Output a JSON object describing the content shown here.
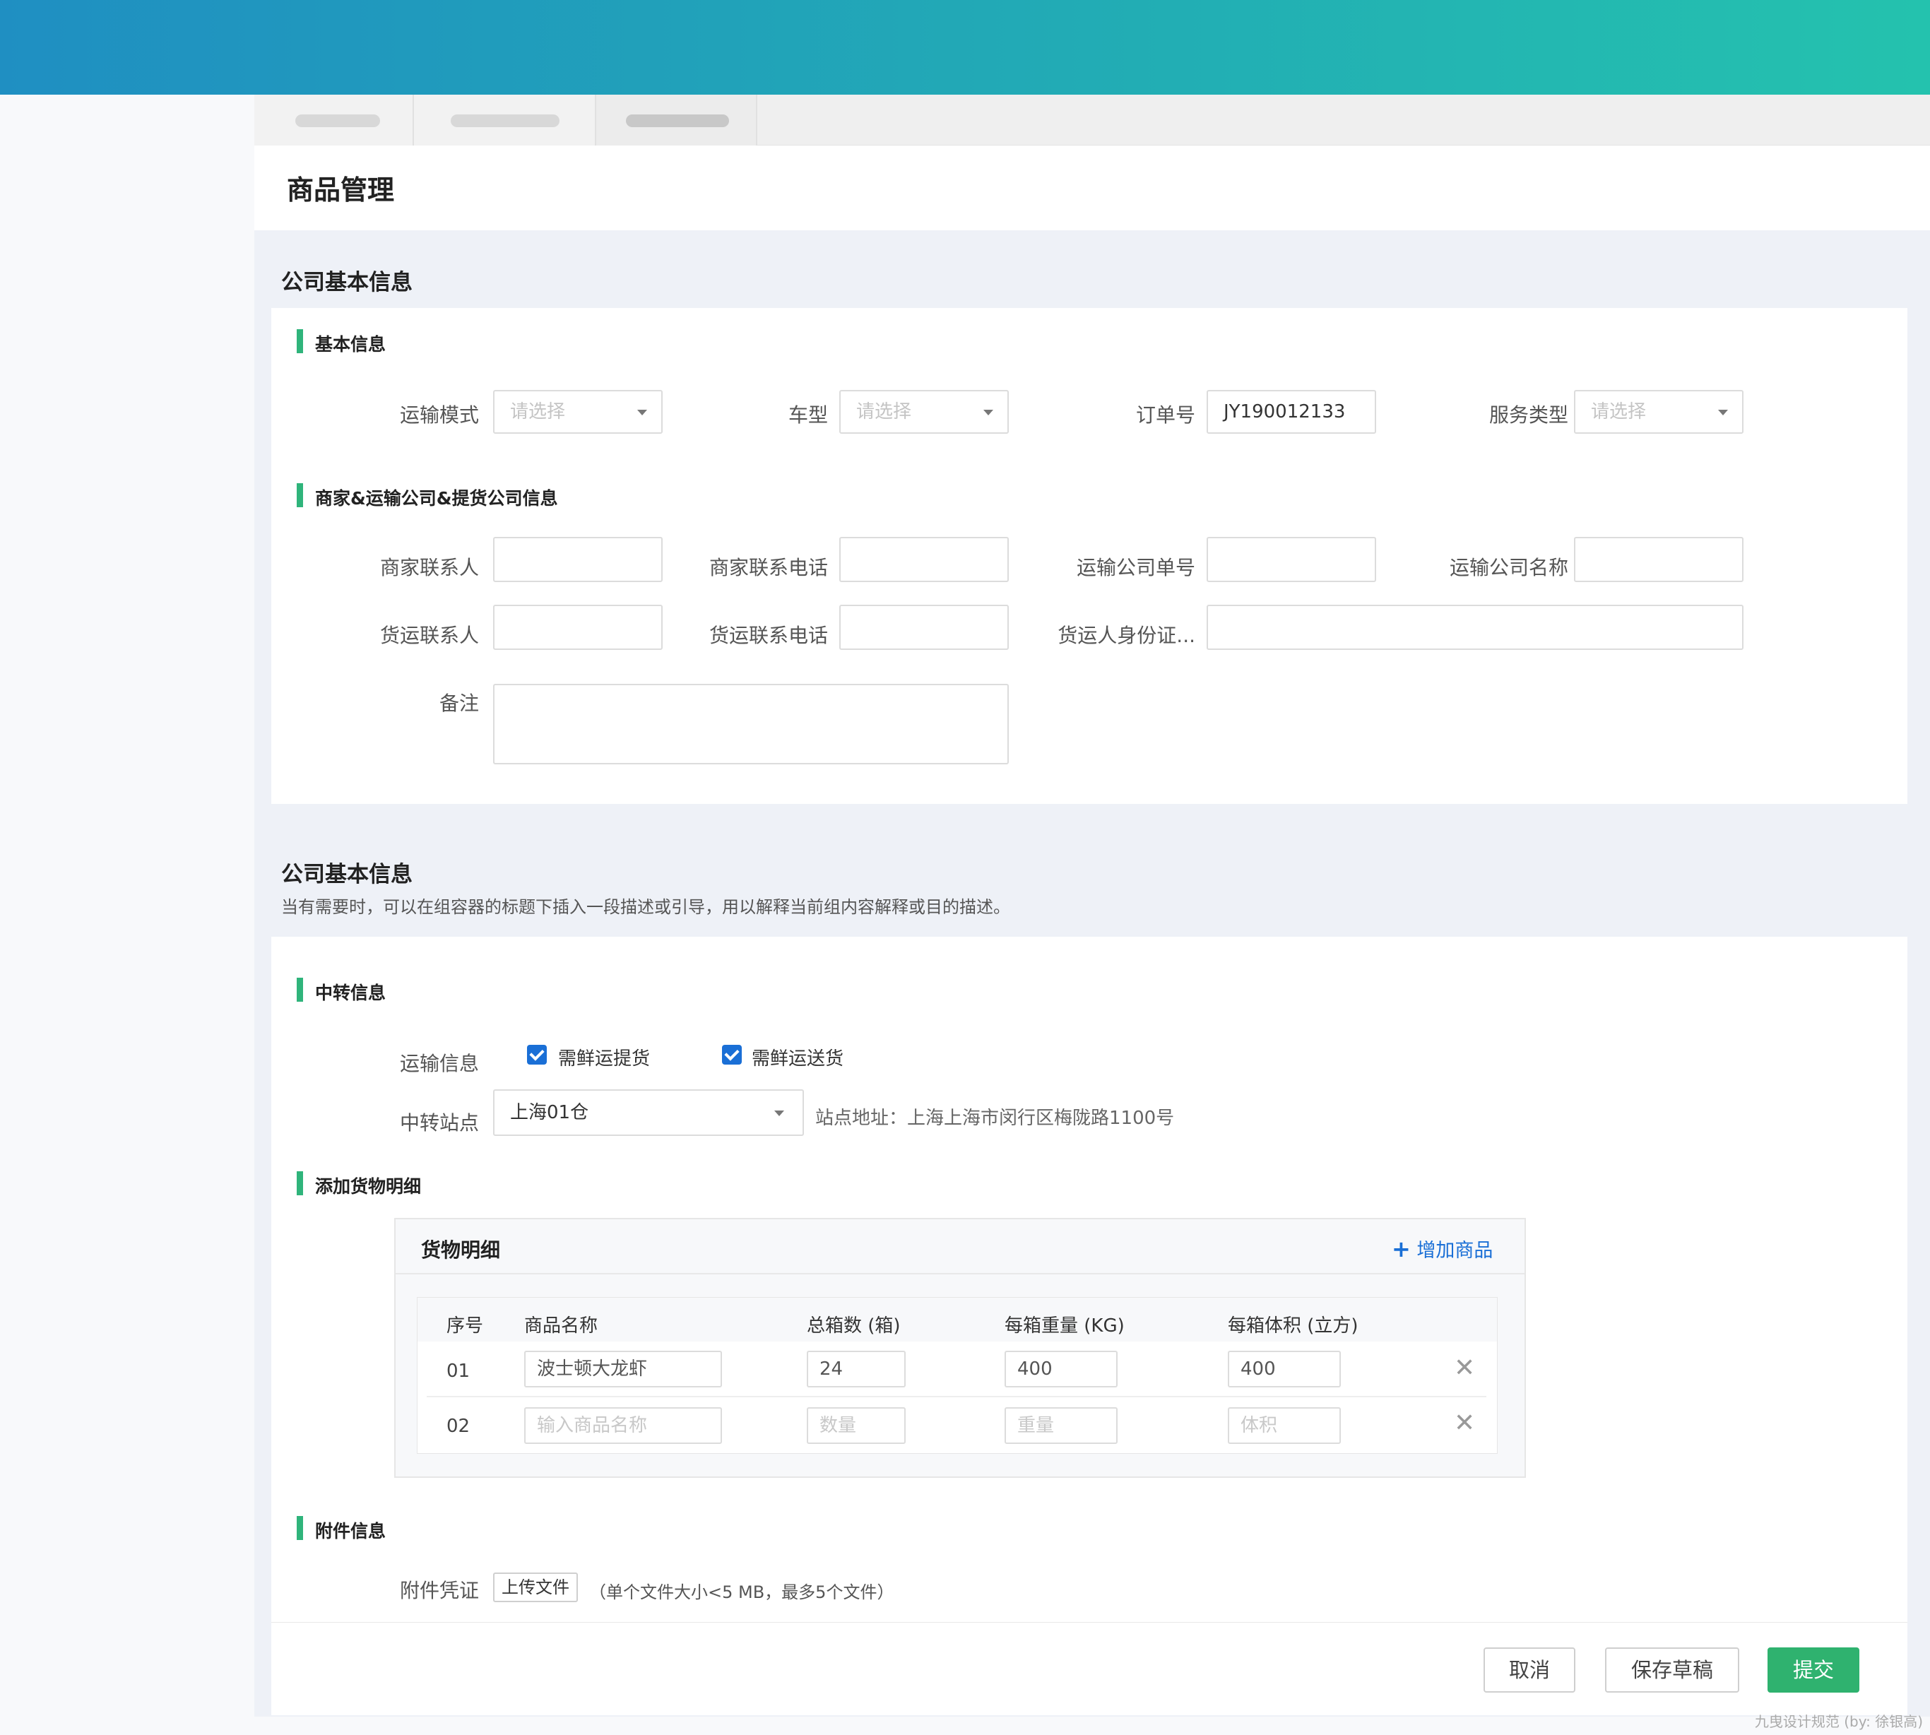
{
  "page": {
    "title": "商品管理"
  },
  "group1": {
    "title": "公司基本信息",
    "basic": {
      "title": "基本信息",
      "transport_mode": {
        "label": "运输模式",
        "placeholder": "请选择"
      },
      "vehicle": {
        "label": "车型",
        "placeholder": "请选择"
      },
      "order_no": {
        "label": "订单号",
        "value": "JY190012133"
      },
      "service_type": {
        "label": "服务类型",
        "placeholder": "请选择"
      }
    },
    "merchant": {
      "title": "商家&运输公司&提货公司信息",
      "merchant_contact": "商家联系人",
      "merchant_phone": "商家联系电话",
      "carrier_no": "运输公司单号",
      "carrier_name": "运输公司名称",
      "freight_contact": "货运联系人",
      "freight_phone": "货运联系电话",
      "freight_id": "货运人身份证...",
      "remark": "备注"
    }
  },
  "group2": {
    "title": "公司基本信息",
    "description": "当有需要时，可以在组容器的标题下插入一段描述或引导，用以解释当前组内容解释或目的描述。",
    "transit": {
      "title": "中转信息",
      "transport_info_label": "运输信息",
      "check1": "需鲜运提货",
      "check2": "需鲜运送货",
      "station_label": "中转站点",
      "station_value": "上海01仓",
      "station_address": "站点地址：上海上海市闵行区梅陇路1100号"
    },
    "cargo": {
      "title": "添加货物明细",
      "box_title": "货物明细",
      "add_link": "增加商品",
      "columns": [
        "序号",
        "商品名称",
        "总箱数 (箱)",
        "每箱重量 (KG)",
        "每箱体积 (立方)"
      ],
      "rows": [
        {
          "no": "01",
          "name": "波士顿大龙虾",
          "count": "24",
          "weight": "400",
          "volume": "400"
        },
        {
          "no": "02",
          "name_ph": "输入商品名称",
          "count_ph": "数量",
          "weight_ph": "重量",
          "volume_ph": "体积"
        }
      ]
    },
    "attachment": {
      "title": "附件信息",
      "label": "附件凭证",
      "upload": "上传文件",
      "hint": "（单个文件大小<5 MB，最多5个文件）"
    }
  },
  "footer": {
    "cancel": "取消",
    "draft": "保存草稿",
    "submit": "提交"
  },
  "watermark": "九曳设计规范 (by: 徐银高)",
  "colors": {
    "accent_green": "#2fb47b",
    "link_blue": "#1a6fd6",
    "primary_button": "#2fb26f"
  }
}
